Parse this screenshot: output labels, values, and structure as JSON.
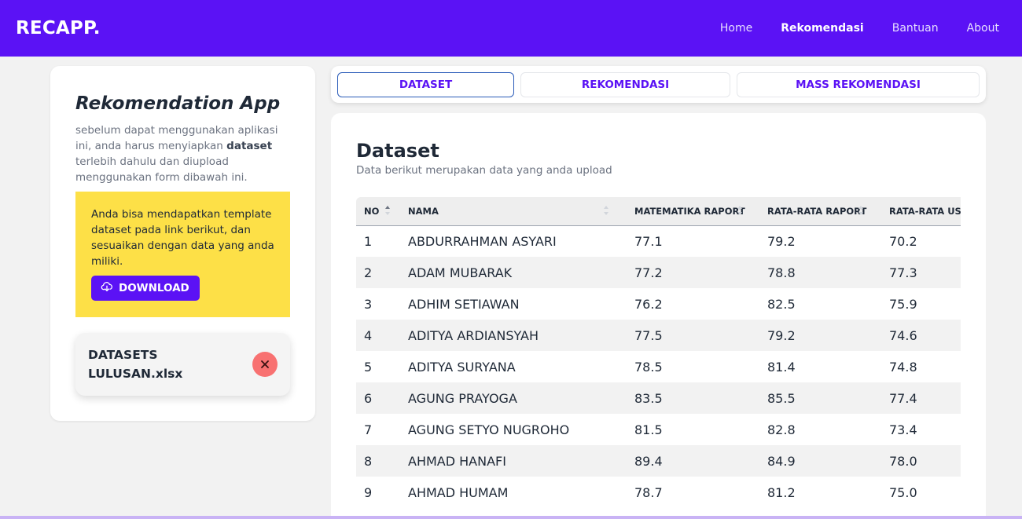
{
  "navbar": {
    "brand": "RECAPP.",
    "links": [
      "Home",
      "Rekomendasi",
      "Bantuan",
      "About"
    ],
    "active": "Rekomendasi"
  },
  "sidebar": {
    "title": "Rekomendation App",
    "intro_before": "sebelum dapat menggunakan aplikasi ini, anda harus menyiapkan ",
    "intro_bold": "dataset",
    "intro_after": " terlebih dahulu dan diupload menggunakan form dibawah ini.",
    "notice": "Anda bisa mendapatkan template dataset pada link berikut, dan sesuaikan dengan data yang anda miliki.",
    "download_label": "DOWNLOAD",
    "file_name": "DATASETS LULUSAN.xlsx"
  },
  "tabs": {
    "dataset": "DATASET",
    "rekomendasi": "REKOMENDASI",
    "mass": "MASS REKOMENDASI"
  },
  "main": {
    "title": "Dataset",
    "subtitle": "Data berikut merupakan data yang anda upload"
  },
  "table": {
    "headers": [
      "NO",
      "NAMA",
      "MATEMATIKA RAPORT",
      "RATA-RATA RAPORT",
      "RATA-RATA US"
    ],
    "rows": [
      [
        "1",
        "ABDURRAHMAN ASYARI",
        "77.1",
        "79.2",
        "70.2"
      ],
      [
        "2",
        "ADAM MUBARAK",
        "77.2",
        "78.8",
        "77.3"
      ],
      [
        "3",
        "ADHIM SETIAWAN",
        "76.2",
        "82.5",
        "75.9"
      ],
      [
        "4",
        "ADITYA ARDIANSYAH",
        "77.5",
        "79.2",
        "74.6"
      ],
      [
        "5",
        "ADITYA SURYANA",
        "78.5",
        "81.4",
        "74.8"
      ],
      [
        "6",
        "AGUNG PRAYOGA",
        "83.5",
        "85.5",
        "77.4"
      ],
      [
        "7",
        "AGUNG SETYO NUGROHO",
        "81.5",
        "82.8",
        "73.4"
      ],
      [
        "8",
        "AHMAD HANAFI",
        "89.4",
        "84.9",
        "78.0"
      ],
      [
        "9",
        "AHMAD HUMAM",
        "78.7",
        "81.2",
        "75.0"
      ]
    ]
  },
  "colors": {
    "primary": "#5b12f5",
    "notice": "#fde047",
    "remove": "#f87171"
  }
}
